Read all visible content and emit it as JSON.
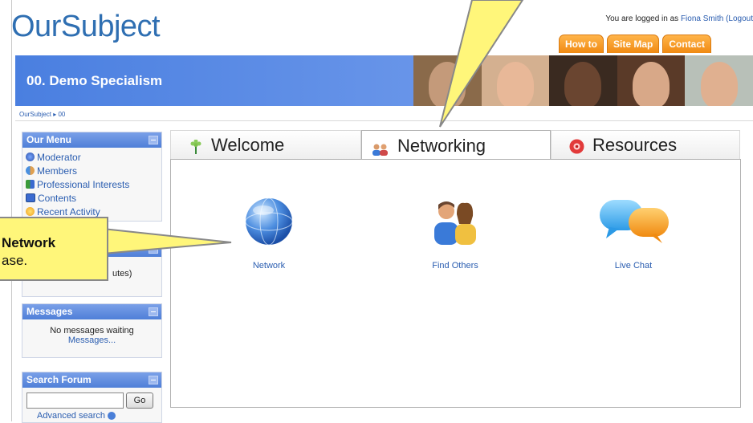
{
  "header": {
    "logo": "OurSubject",
    "login_prefix": "You are logged in as ",
    "login_name": "Fiona Smith",
    "login_suffix": " (Logout",
    "tabs": [
      "How to",
      "Site Map",
      "Contact"
    ]
  },
  "banner": {
    "title": "00. Demo Specialism"
  },
  "breadcrumb": "OurSubject ▸ 00",
  "menu": {
    "title": "Our Menu",
    "items": [
      "Moderator",
      "Members",
      "Professional Interests",
      "Contents",
      "Recent Activity"
    ]
  },
  "online_block": {
    "partial_text": "utes)"
  },
  "messages": {
    "title": "Messages",
    "status": "No messages waiting",
    "link": "Messages..."
  },
  "search": {
    "title": "Search Forum",
    "input_value": "",
    "button": "Go",
    "advanced": "Advanced search"
  },
  "tabs": [
    {
      "label": "Welcome",
      "icon": "flower-icon"
    },
    {
      "label": "Networking",
      "icon": "people-icon",
      "active": true
    },
    {
      "label": "Resources",
      "icon": "resources-icon"
    }
  ],
  "apps": [
    {
      "label": "Network",
      "icon": "globe-icon"
    },
    {
      "label": "Find Others",
      "icon": "find-others-icon"
    },
    {
      "label": "Live Chat",
      "icon": "chat-bubbles-icon"
    }
  ],
  "callout": {
    "line1": "Network",
    "line2": "ase."
  },
  "colors": {
    "brand_blue": "#2f6fb2",
    "banner_blue": "#5a8ae6",
    "tab_orange": "#f49a1e",
    "callout_yellow": "#fff67a"
  }
}
